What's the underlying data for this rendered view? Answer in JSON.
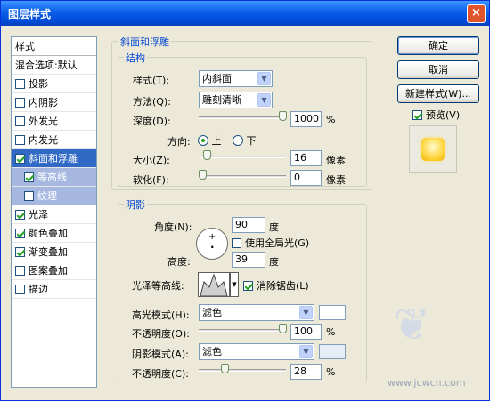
{
  "window": {
    "title": "图层样式",
    "close": "×"
  },
  "sidebar": {
    "header": "样式",
    "items": [
      {
        "label": "混合选项:默认",
        "checkbox": false,
        "state": "normal"
      },
      {
        "label": "投影",
        "checkbox": true,
        "checked": false,
        "state": "normal"
      },
      {
        "label": "内阴影",
        "checkbox": true,
        "checked": false,
        "state": "normal"
      },
      {
        "label": "外发光",
        "checkbox": true,
        "checked": false,
        "state": "normal"
      },
      {
        "label": "内发光",
        "checkbox": true,
        "checked": false,
        "state": "normal"
      },
      {
        "label": "斜面和浮雕",
        "checkbox": true,
        "checked": true,
        "state": "selected"
      },
      {
        "label": "等高线",
        "checkbox": true,
        "checked": true,
        "state": "sub"
      },
      {
        "label": "纹理",
        "checkbox": true,
        "checked": false,
        "state": "sub"
      },
      {
        "label": "光泽",
        "checkbox": true,
        "checked": true,
        "state": "normal"
      },
      {
        "label": "颜色叠加",
        "checkbox": true,
        "checked": true,
        "state": "normal"
      },
      {
        "label": "渐变叠加",
        "checkbox": true,
        "checked": true,
        "state": "normal"
      },
      {
        "label": "图案叠加",
        "checkbox": true,
        "checked": false,
        "state": "normal"
      },
      {
        "label": "描边",
        "checkbox": true,
        "checked": false,
        "state": "normal"
      }
    ]
  },
  "bevel": {
    "group_title": "斜面和浮雕",
    "structure_title": "结构",
    "style_label": "样式(T):",
    "style_value": "内斜面",
    "technique_label": "方法(Q):",
    "technique_value": "雕刻清晰",
    "depth_label": "深度(D):",
    "depth_value": "1000",
    "depth_unit": "%",
    "depth_level": 1.0,
    "direction_label": "方向:",
    "dir_up": "上",
    "dir_down": "下",
    "direction": "up",
    "size_label": "大小(Z):",
    "size_value": "16",
    "size_unit": "像素",
    "size_level": 0.06,
    "soften_label": "软化(F):",
    "soften_value": "0",
    "soften_unit": "像素",
    "soften_level": 0.0
  },
  "shading": {
    "title": "阴影",
    "angle_label": "角度(N):",
    "angle_value": "90",
    "angle_unit": "度",
    "global_light_label": "使用全局光(G)",
    "global_light": false,
    "altitude_label": "高度:",
    "altitude_value": "39",
    "altitude_unit": "度",
    "gloss_label": "光泽等高线:",
    "antialias_label": "消除锯齿(L)",
    "antialias": true,
    "highlight_mode_label": "高光模式(H):",
    "highlight_mode": "滤色",
    "highlight_color": "#ffffff",
    "highlight_opacity_label": "不透明度(O):",
    "highlight_opacity": "100",
    "highlight_level": 1.0,
    "shadow_mode_label": "阴影模式(A):",
    "shadow_mode": "滤色",
    "shadow_color": "#e4eef4",
    "shadow_opacity_label": "不透明度(C):",
    "shadow_opacity": "28",
    "shadow_level": 0.28,
    "percent": "%"
  },
  "buttons": {
    "ok": "确定",
    "cancel": "取消",
    "new_style": "新建样式(W)...",
    "preview_label": "预览(V)",
    "preview": true
  },
  "colors": {
    "titlebar": "#0a5ee8",
    "selected": "#316ac5",
    "group_label": "#0046d5",
    "preview_gold": "#ffd94a"
  },
  "watermark": "www.jcwcn.com"
}
